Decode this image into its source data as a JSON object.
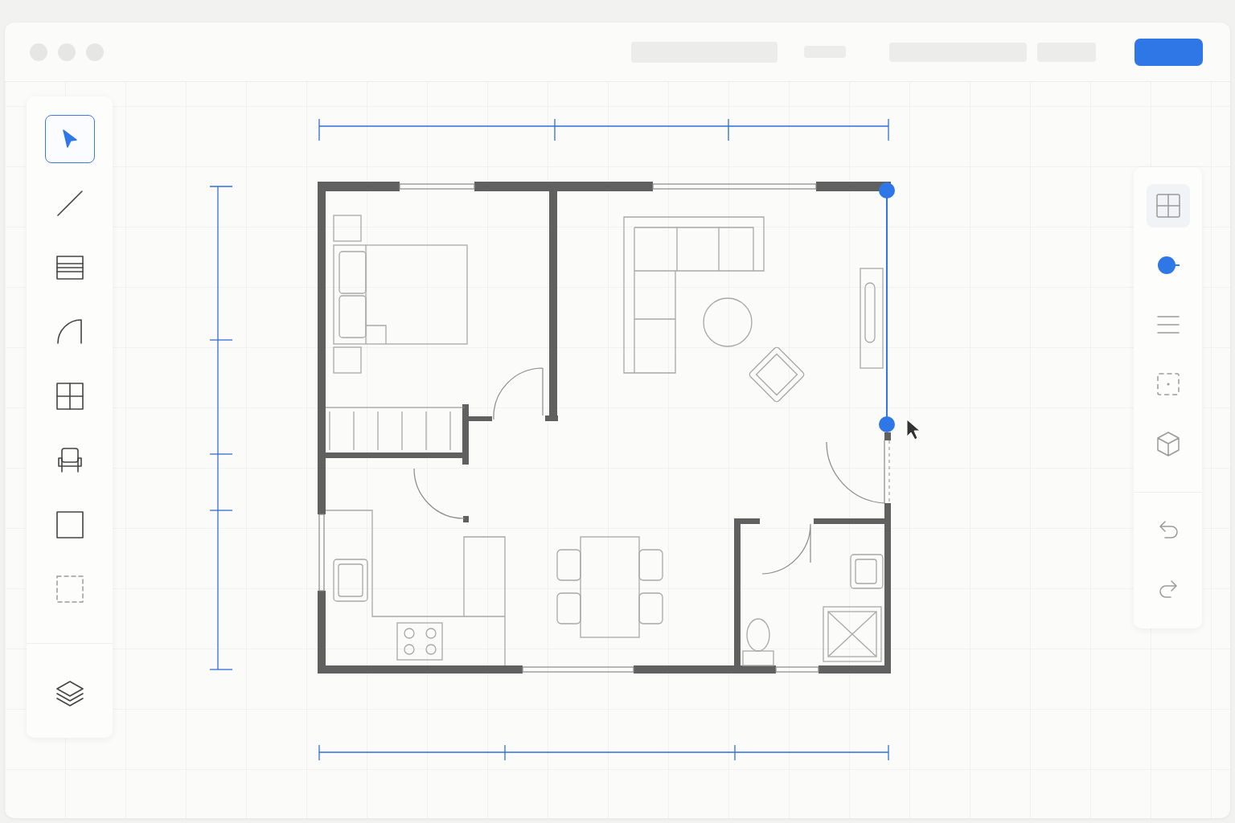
{
  "left_tools": [
    {
      "kind": "select",
      "selected": true
    },
    {
      "kind": "line",
      "selected": false
    },
    {
      "kind": "wall",
      "selected": false
    },
    {
      "kind": "door",
      "selected": false
    },
    {
      "kind": "window",
      "selected": false
    },
    {
      "kind": "furniture",
      "selected": false
    },
    {
      "kind": "room",
      "selected": false
    },
    {
      "kind": "area",
      "selected": false
    },
    {
      "kind": "layers",
      "selected": false
    }
  ],
  "right_tools": [
    {
      "kind": "grid",
      "selected": true
    },
    {
      "kind": "point",
      "selected": false
    },
    {
      "kind": "align",
      "selected": false
    },
    {
      "kind": "marquee",
      "selected": false
    },
    {
      "kind": "cube",
      "selected": false
    },
    {
      "kind": "undo",
      "selected": false
    },
    {
      "kind": "redo",
      "selected": false
    }
  ]
}
